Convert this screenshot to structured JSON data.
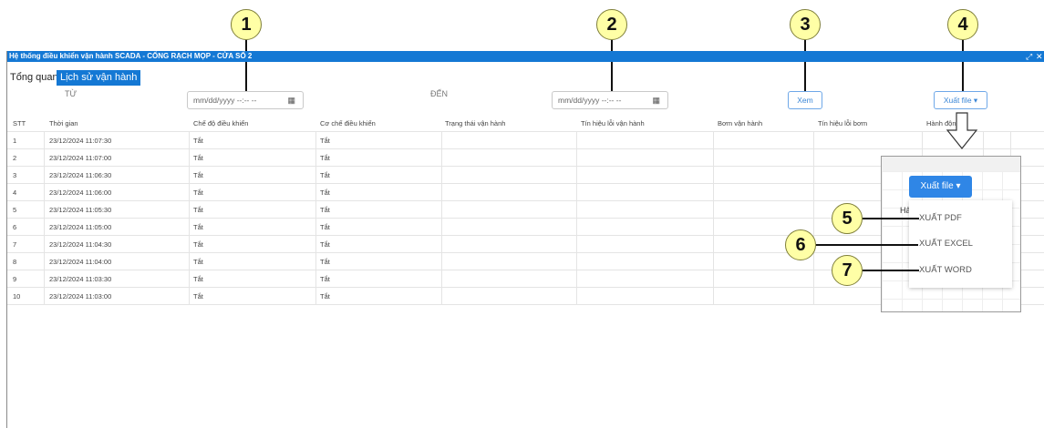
{
  "window": {
    "title": "Hệ thống điều khiển vận hành SCADA - CỐNG RẠCH MỌP - CỬA SỐ 2",
    "controls": [
      "⤢",
      "✕"
    ]
  },
  "tabs": [
    {
      "label": "Tổng quan",
      "active": false
    },
    {
      "label": "Lịch sử vận hành",
      "active": true
    }
  ],
  "filters": {
    "from_label": "TỪ",
    "to_label": "ĐẾN",
    "from_placeholder": "mm/dd/yyyy --:-- --",
    "to_placeholder": "mm/dd/yyyy --:-- --",
    "view_button": "Xem",
    "export_button": "Xuất file ▾"
  },
  "table": {
    "headers": [
      "STT",
      "Thời gian",
      "Chế độ điều khiển",
      "Cơ chế điều khiển",
      "Trạng thái vận hành",
      "Tín hiệu lỗi vận hành",
      "Bơm vận hành",
      "Tín hiệu lỗi bơm",
      "Hành động"
    ],
    "rows": [
      [
        "1",
        "23/12/2024 11:07:30",
        "Tắt",
        "Tắt"
      ],
      [
        "2",
        "23/12/2024 11:07:00",
        "Tắt",
        "Tắt"
      ],
      [
        "3",
        "23/12/2024 11:06:30",
        "Tắt",
        "Tắt"
      ],
      [
        "4",
        "23/12/2024 11:06:00",
        "Tắt",
        "Tắt"
      ],
      [
        "5",
        "23/12/2024 11:05:30",
        "Tắt",
        "Tắt"
      ],
      [
        "6",
        "23/12/2024 11:05:00",
        "Tắt",
        "Tắt"
      ],
      [
        "7",
        "23/12/2024 11:04:30",
        "Tắt",
        "Tắt"
      ],
      [
        "8",
        "23/12/2024 11:04:00",
        "Tắt",
        "Tắt"
      ],
      [
        "9",
        "23/12/2024 11:03:30",
        "Tắt",
        "Tắt"
      ],
      [
        "10",
        "23/12/2024 11:03:00",
        "Tắt",
        "Tắt"
      ]
    ]
  },
  "zoom_panel": {
    "button": "Xuất file ▾",
    "hint": "Hả",
    "menu": [
      "XUẤT PDF",
      "XUẤT EXCEL",
      "XUẤT WORD"
    ]
  },
  "callouts": [
    "1",
    "2",
    "3",
    "4",
    "5",
    "6",
    "7"
  ],
  "colors": {
    "titlebar": "#1478d4",
    "bubble": "#ffffa6",
    "accent": "#2f86e6"
  }
}
